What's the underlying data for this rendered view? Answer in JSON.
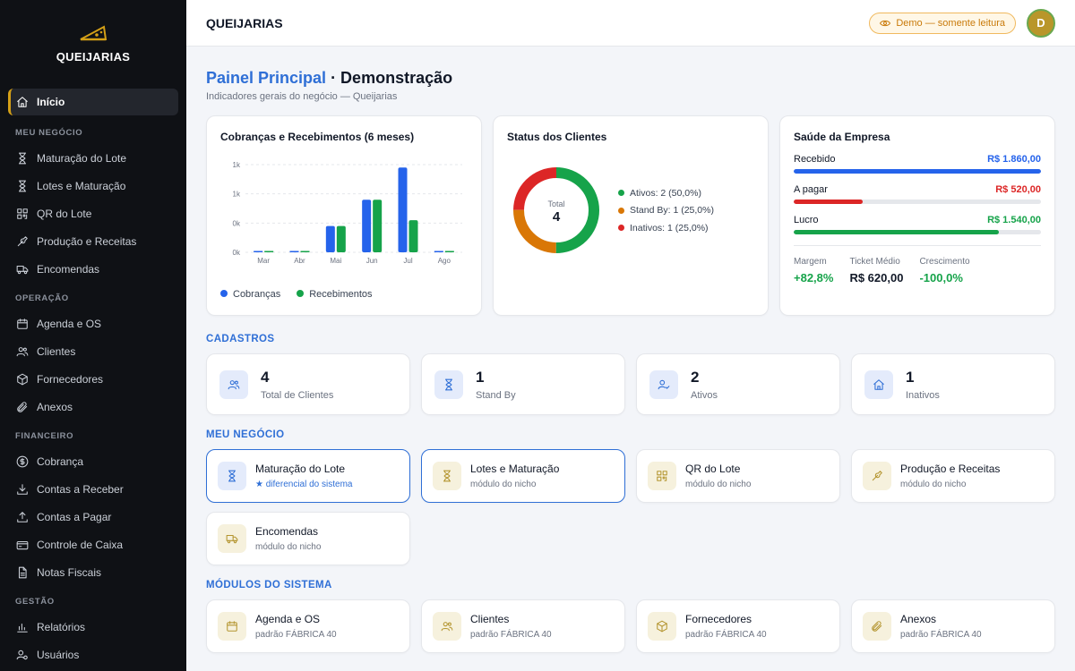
{
  "brand": {
    "name": "QUEIJARIAS"
  },
  "sidebar": {
    "home": "Início",
    "sections": [
      {
        "title": "MEU NEGÓCIO",
        "items": [
          {
            "label": "Maturação do Lote",
            "icon": "hourglass-icon"
          },
          {
            "label": "Lotes e Maturação",
            "icon": "hourglass-icon"
          },
          {
            "label": "QR do Lote",
            "icon": "qr-icon"
          },
          {
            "label": "Produção e Receitas",
            "icon": "wrench-icon"
          },
          {
            "label": "Encomendas",
            "icon": "truck-icon"
          }
        ]
      },
      {
        "title": "OPERAÇÃO",
        "items": [
          {
            "label": "Agenda e OS",
            "icon": "calendar-icon"
          },
          {
            "label": "Clientes",
            "icon": "users-icon"
          },
          {
            "label": "Fornecedores",
            "icon": "box-icon"
          },
          {
            "label": "Anexos",
            "icon": "paperclip-icon"
          }
        ]
      },
      {
        "title": "FINANCEIRO",
        "items": [
          {
            "label": "Cobrança",
            "icon": "dollar-icon"
          },
          {
            "label": "Contas a Receber",
            "icon": "download-icon"
          },
          {
            "label": "Contas a Pagar",
            "icon": "upload-icon"
          },
          {
            "label": "Controle de Caixa",
            "icon": "wallet-icon"
          },
          {
            "label": "Notas Fiscais",
            "icon": "document-icon"
          }
        ]
      },
      {
        "title": "GESTÃO",
        "items": [
          {
            "label": "Relatórios",
            "icon": "bar-chart-icon"
          },
          {
            "label": "Usuários",
            "icon": "user-gear-icon"
          }
        ]
      }
    ]
  },
  "topbar": {
    "title": "QUEIJARIAS",
    "badge": "Demo — somente leitura",
    "avatar": "D"
  },
  "page": {
    "title_accent": "Painel Principal",
    "title_rest": " · Demonstração",
    "subtitle": "Indicadores gerais do negócio — Queijarias"
  },
  "chart_card": {
    "title": "Cobranças e Recebimentos (6 meses)"
  },
  "chart_data": {
    "type": "bar",
    "categories": [
      "Mar",
      "Abr",
      "Mai",
      "Jun",
      "Jul",
      "Ago"
    ],
    "y_tick_labels": [
      "1k",
      "1k",
      "0k",
      "0k"
    ],
    "y_tick_values": [
      1200,
      800,
      400,
      0
    ],
    "ylim": [
      0,
      1200
    ],
    "series": [
      {
        "name": "Cobranças",
        "color": "#2563eb",
        "values": [
          0,
          0,
          360,
          720,
          1160,
          0
        ]
      },
      {
        "name": "Recebimentos",
        "color": "#16a34a",
        "values": [
          0,
          0,
          360,
          720,
          440,
          0
        ]
      }
    ]
  },
  "status_card": {
    "title": "Status dos Clientes",
    "total_label": "Total",
    "total_value": "4",
    "legend": [
      {
        "label": "Ativos: 2 (50,0%)",
        "color": "#16a34a",
        "value": 2
      },
      {
        "label": "Stand By: 1 (25,0%)",
        "color": "#d97706",
        "value": 1
      },
      {
        "label": "Inativos: 1 (25,0%)",
        "color": "#dc2626",
        "value": 1
      }
    ]
  },
  "health_card": {
    "title": "Saúde da Empresa",
    "rows": [
      {
        "label": "Recebido",
        "value": "R$ 1.860,00",
        "color": "#2563eb",
        "fill": 1.0
      },
      {
        "label": "A pagar",
        "value": "R$ 520,00",
        "color": "#dc2626",
        "fill": 0.28
      },
      {
        "label": "Lucro",
        "value": "R$ 1.540,00",
        "color": "#16a34a",
        "fill": 0.83
      }
    ],
    "metrics": [
      {
        "label": "Margem",
        "value": "+82,8%",
        "color": "#16a34a"
      },
      {
        "label": "Ticket Médio",
        "value": "R$ 620,00",
        "color": "#111827"
      },
      {
        "label": "Crescimento",
        "value": "-100,0%",
        "color": "#16a34a"
      }
    ]
  },
  "cadastros": {
    "title": "CADASTROS",
    "items": [
      {
        "num": "4",
        "label": "Total de Clientes",
        "icon": "users-icon"
      },
      {
        "num": "1",
        "label": "Stand By",
        "icon": "hourglass-icon"
      },
      {
        "num": "2",
        "label": "Ativos",
        "icon": "user-check-icon"
      },
      {
        "num": "1",
        "label": "Inativos",
        "icon": "home-icon"
      }
    ]
  },
  "meu_negocio": {
    "title": "MEU NEGÓCIO",
    "items": [
      {
        "name": "Maturação do Lote",
        "sub": "★ diferencial do sistema",
        "icon": "hourglass-icon"
      },
      {
        "name": "Lotes e Maturação",
        "sub": "módulo do nicho",
        "icon": "hourglass-icon"
      },
      {
        "name": "QR do Lote",
        "sub": "módulo do nicho",
        "icon": "qr-icon"
      },
      {
        "name": "Produção e Receitas",
        "sub": "módulo do nicho",
        "icon": "wrench-icon"
      },
      {
        "name": "Encomendas",
        "sub": "módulo do nicho",
        "icon": "truck-icon"
      }
    ]
  },
  "modulos": {
    "title": "MÓDULOS DO SISTEMA",
    "items": [
      {
        "name": "Agenda e OS",
        "sub": "padrão FÁBRICA 40",
        "icon": "calendar-icon"
      },
      {
        "name": "Clientes",
        "sub": "padrão FÁBRICA 40",
        "icon": "users-icon"
      },
      {
        "name": "Fornecedores",
        "sub": "padrão FÁBRICA 40",
        "icon": "box-icon"
      },
      {
        "name": "Anexos",
        "sub": "padrão FÁBRICA 40",
        "icon": "paperclip-icon"
      }
    ]
  }
}
